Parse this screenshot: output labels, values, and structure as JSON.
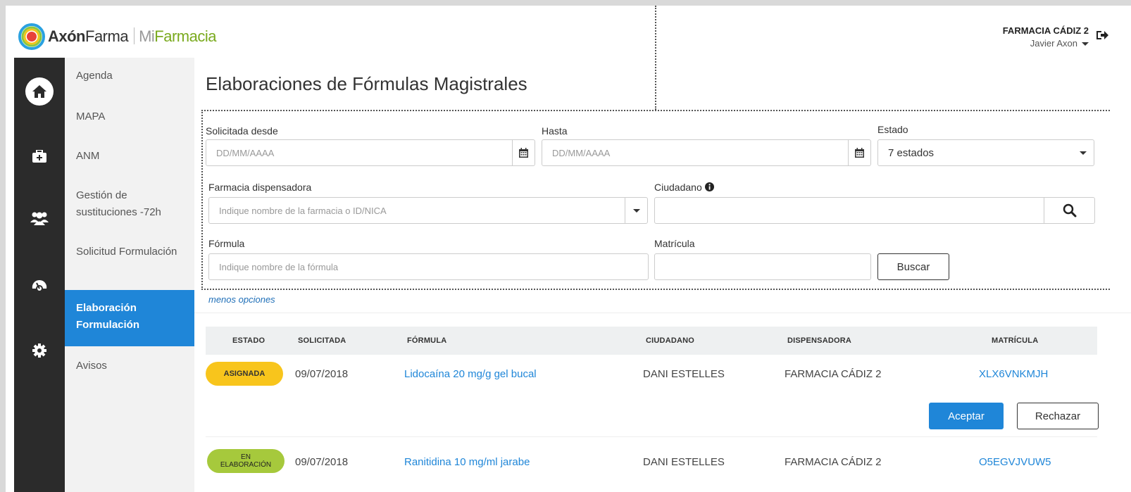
{
  "brand": {
    "axon_bold": "Axón",
    "axon_thin": "Farma",
    "mi": "Mi",
    "farmacia": "Farmacia",
    "colors": {
      "green": "#7aaa1e",
      "ring_red": "#e8413b",
      "ring_blue": "#2aa1e0",
      "ring_yellow": "#f3c41b",
      "ring_green": "#8cc63f"
    }
  },
  "user": {
    "pharmacy": "FARMACIA CÁDIZ 2",
    "name": "Javier Axon"
  },
  "rail": {
    "icons": [
      "home-icon",
      "medical-kit-icon",
      "users-icon",
      "dashboard-icon",
      "gear-icon"
    ]
  },
  "submenu": {
    "items": [
      {
        "label": "Agenda"
      },
      {
        "label": "MAPA"
      },
      {
        "label": "ANM"
      },
      {
        "label": "Gestión de sustituciones -72h"
      },
      {
        "label": "Solicitud Formulación"
      },
      {
        "label": "Elaboración Formulación",
        "active": true
      },
      {
        "label": "Avisos"
      }
    ]
  },
  "page": {
    "title": "Elaboraciones de Fórmulas Magistrales"
  },
  "filters": {
    "from_label": "Solicitada desde",
    "from_placeholder": "DD/MM/AAAA",
    "to_label": "Hasta",
    "to_placeholder": "DD/MM/AAAA",
    "estado_label": "Estado",
    "estado_value": "7 estados",
    "pharmacy_label": "Farmacia dispensadora",
    "pharmacy_placeholder": "Indique nombre de la farmacia o ID/NICA",
    "citizen_label": "Ciudadano",
    "formula_label": "Fórmula",
    "formula_placeholder": "Indique nombre de la fórmula",
    "matricula_label": "Matrícula",
    "search_button": "Buscar",
    "less_options": "menos opciones"
  },
  "table": {
    "headers": [
      "ESTADO",
      "SOLICITADA",
      "FÓRMULA",
      "CIUDADANO",
      "DISPENSADORA",
      "MATRÍCULA"
    ],
    "rows": [
      {
        "estado": "ASIGNADA",
        "solicitada": "09/07/2018",
        "formula": "Lidocaína 20 mg/g gel bucal",
        "ciudadano": "DANI ESTELLES",
        "dispensadora": "FARMACIA CÁDIZ 2",
        "matricula": "XLX6VNKMJH",
        "accept": "Aceptar",
        "reject": "Rechazar"
      },
      {
        "estado_l1": "EN",
        "estado_l2": "ELABORACIÓN",
        "solicitada": "09/07/2018",
        "formula": "Ranitidina 10 mg/ml jarabe",
        "ciudadano": "DANI ESTELLES",
        "dispensadora": "FARMACIA CÁDIZ 2",
        "matricula": "O5EGVJVUW5"
      }
    ]
  }
}
